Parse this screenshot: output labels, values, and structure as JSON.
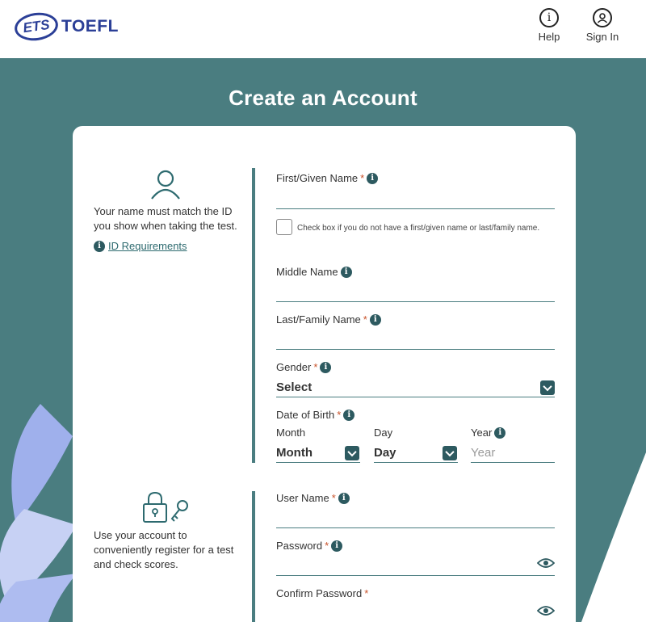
{
  "header": {
    "logo_ets": "ETS",
    "logo_toefl": "TOEFL",
    "help_label": "Help",
    "signin_label": "Sign In"
  },
  "page": {
    "title": "Create an Account"
  },
  "name_section": {
    "note": "Your name must match the ID you show when taking the test.",
    "id_link": "ID Requirements",
    "first_name_label": "First/Given Name",
    "no_name_checkbox": "Check box if you do not have a first/given name or last/family name.",
    "middle_name_label": "Middle Name",
    "last_name_label": "Last/Family Name",
    "gender_label": "Gender",
    "gender_value": "Select",
    "dob_label": "Date of Birth",
    "month_label": "Month",
    "month_value": "Month",
    "day_label": "Day",
    "day_value": "Day",
    "year_label": "Year",
    "year_placeholder": "Year"
  },
  "account_section": {
    "note": "Use your account to conveniently register for a test and check scores.",
    "username_label": "User Name",
    "password_label": "Password",
    "confirm_password_label": "Confirm Password"
  },
  "required_mark": "*",
  "info_glyph": "i",
  "colors": {
    "teal": "#4a7d80",
    "dark_teal": "#2d5a60",
    "required": "#c8522a",
    "brand": "#2b3f97"
  }
}
